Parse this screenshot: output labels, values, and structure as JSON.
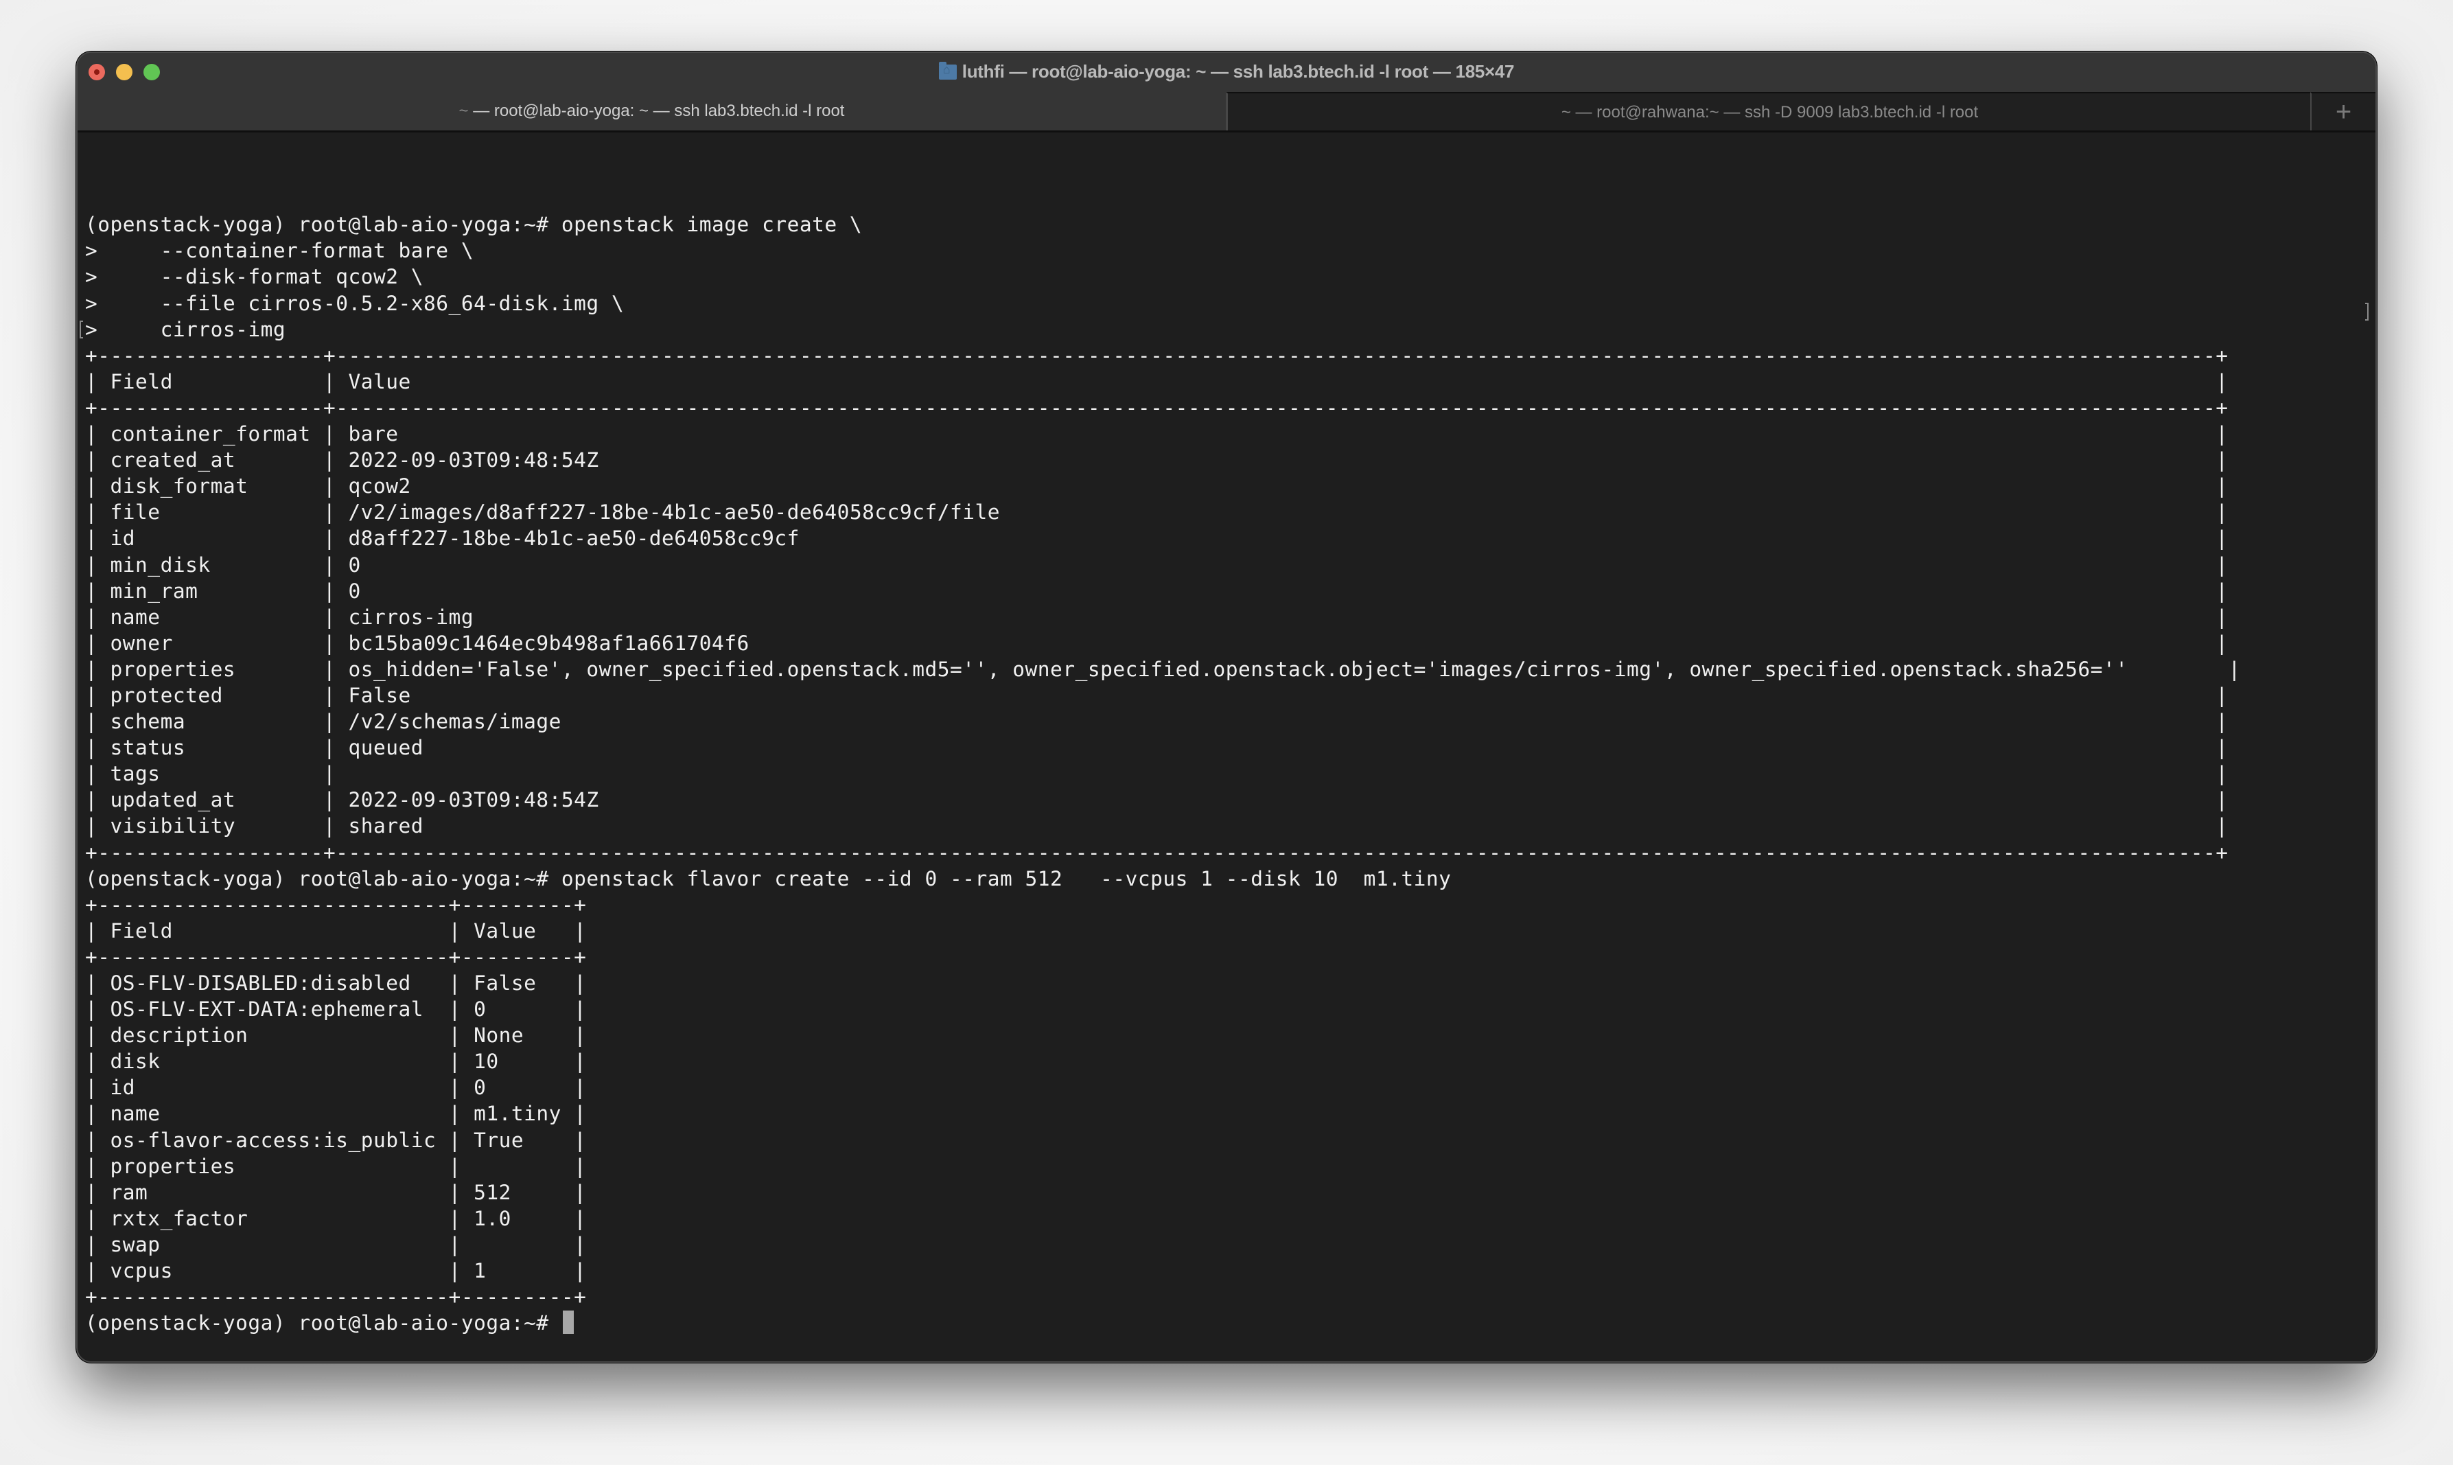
{
  "window": {
    "title": "luthfi — root@lab-aio-yoga: ~ — ssh lab3.btech.id -l root — 185×47",
    "title_icon": "folder-home-icon",
    "traffic_lights": {
      "close": "#ec6a5e",
      "minimize": "#f4bf4f",
      "maximize": "#61c554"
    }
  },
  "tabs": [
    {
      "prefix": "~",
      "label": "— root@lab-aio-yoga: ~ — ssh lab3.btech.id -l root",
      "active": true
    },
    {
      "prefix": "~",
      "label": "— root@rahwana:~ — ssh -D 9009 lab3.btech.id -l root",
      "active": false
    }
  ],
  "new_tab_label": "+",
  "colors": {
    "terminal_bg": "#1e1e1e",
    "terminal_fg": "#f0f0f0",
    "titlebar_bg": "#353535",
    "inactive_tab_bg": "#202020",
    "cursor": "#a8a8a8"
  },
  "terminal": {
    "lines": [
      "(openstack-yoga) root@lab-aio-yoga:~# openstack image create \\",
      ">     --container-format bare \\",
      ">     --disk-format qcow2 \\",
      ">     --file cirros-0.5.2-x86_64-disk.img \\",
      ">     cirros-img",
      "+------------------+------------------------------------------------------------------------------------------------------------------------------------------------------+",
      "| Field            | Value                                                                                                                                                |",
      "+------------------+------------------------------------------------------------------------------------------------------------------------------------------------------+",
      "| container_format | bare                                                                                                                                                 |",
      "| created_at       | 2022-09-03T09:48:54Z                                                                                                                                 |",
      "| disk_format      | qcow2                                                                                                                                                |",
      "| file             | /v2/images/d8aff227-18be-4b1c-ae50-de64058cc9cf/file                                                                                                 |",
      "| id               | d8aff227-18be-4b1c-ae50-de64058cc9cf                                                                                                                 |",
      "| min_disk         | 0                                                                                                                                                    |",
      "| min_ram          | 0                                                                                                                                                    |",
      "| name             | cirros-img                                                                                                                                           |",
      "| owner            | bc15ba09c1464ec9b498af1a661704f6                                                                                                                     |",
      "| properties       | os_hidden='False', owner_specified.openstack.md5='', owner_specified.openstack.object='images/cirros-img', owner_specified.openstack.sha256=''        |",
      "| protected        | False                                                                                                                                                |",
      "| schema           | /v2/schemas/image                                                                                                                                    |",
      "| status           | queued                                                                                                                                               |",
      "| tags             |                                                                                                                                                      |",
      "| updated_at       | 2022-09-03T09:48:54Z                                                                                                                                 |",
      "| visibility       | shared                                                                                                                                               |",
      "+------------------+------------------------------------------------------------------------------------------------------------------------------------------------------+",
      "(openstack-yoga) root@lab-aio-yoga:~# openstack flavor create --id 0 --ram 512   --vcpus 1 --disk 10  m1.tiny",
      "+----------------------------+---------+",
      "| Field                      | Value   |",
      "+----------------------------+---------+",
      "| OS-FLV-DISABLED:disabled   | False   |",
      "| OS-FLV-EXT-DATA:ephemeral  | 0       |",
      "| description                | None    |",
      "| disk                       | 10      |",
      "| id                         | 0       |",
      "| name                       | m1.tiny |",
      "| os-flavor-access:is_public | True    |",
      "| properties                 |         |",
      "| ram                        | 512     |",
      "| rxtx_factor                | 1.0     |",
      "| swap                       |         |",
      "| vcpus                      | 1       |",
      "+----------------------------+---------+"
    ],
    "prompt": "(openstack-yoga) root@lab-aio-yoga:~# "
  },
  "image_table": {
    "columns": [
      "Field",
      "Value"
    ],
    "rows": [
      [
        "container_format",
        "bare"
      ],
      [
        "created_at",
        "2022-09-03T09:48:54Z"
      ],
      [
        "disk_format",
        "qcow2"
      ],
      [
        "file",
        "/v2/images/d8aff227-18be-4b1c-ae50-de64058cc9cf/file"
      ],
      [
        "id",
        "d8aff227-18be-4b1c-ae50-de64058cc9cf"
      ],
      [
        "min_disk",
        "0"
      ],
      [
        "min_ram",
        "0"
      ],
      [
        "name",
        "cirros-img"
      ],
      [
        "owner",
        "bc15ba09c1464ec9b498af1a661704f6"
      ],
      [
        "properties",
        "os_hidden='False', owner_specified.openstack.md5='', owner_specified.openstack.object='images/cirros-img', owner_specified.openstack.sha256=''"
      ],
      [
        "protected",
        "False"
      ],
      [
        "schema",
        "/v2/schemas/image"
      ],
      [
        "status",
        "queued"
      ],
      [
        "tags",
        ""
      ],
      [
        "updated_at",
        "2022-09-03T09:48:54Z"
      ],
      [
        "visibility",
        "shared"
      ]
    ]
  },
  "flavor_table": {
    "columns": [
      "Field",
      "Value"
    ],
    "rows": [
      [
        "OS-FLV-DISABLED:disabled",
        "False"
      ],
      [
        "OS-FLV-EXT-DATA:ephemeral",
        "0"
      ],
      [
        "description",
        "None"
      ],
      [
        "disk",
        "10"
      ],
      [
        "id",
        "0"
      ],
      [
        "name",
        "m1.tiny"
      ],
      [
        "os-flavor-access:is_public",
        "True"
      ],
      [
        "properties",
        ""
      ],
      [
        "ram",
        "512"
      ],
      [
        "rxtx_factor",
        "1.0"
      ],
      [
        "swap",
        ""
      ],
      [
        "vcpus",
        "1"
      ]
    ]
  }
}
